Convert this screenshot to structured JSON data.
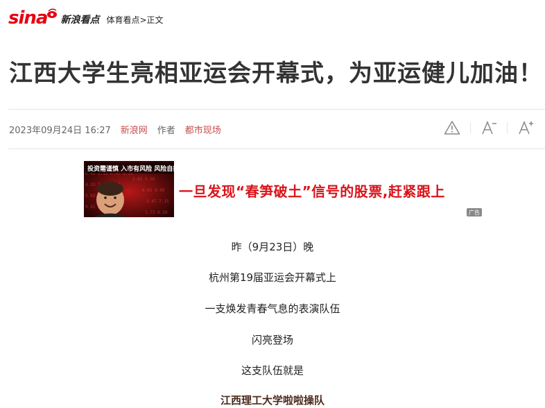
{
  "header": {
    "logo_text": "sina",
    "logo_cn": "新浪看点",
    "breadcrumb": "体育看点>正文"
  },
  "article": {
    "title": "江西大学生亮相亚运会开幕式，为亚运健儿加油！",
    "date": "2023年09月24日 16:27",
    "source": "新浪网",
    "author_label": "作者",
    "author": "都市现场"
  },
  "tools": {
    "report_icon": "warning-icon",
    "font_decrease_icon": "font-decrease-icon",
    "font_increase_icon": "font-increase-icon"
  },
  "ad": {
    "image_caption": "投资需谨慎 入市有风险 风险自担",
    "headline": "一旦发现“春笋破土”信号的股票,赶紧跟上",
    "badge": "广告"
  },
  "body": [
    "昨（9月23日）晚",
    "杭州第19届亚运会开幕式上",
    "一支焕发青春气息的表演队伍",
    "闪亮登场",
    "这支队伍就是",
    "江西理工大学啦啦操队"
  ],
  "colors": {
    "brand_red": "#e60012",
    "link_red": "#c94c4c",
    "ad_red": "#d8141b"
  }
}
